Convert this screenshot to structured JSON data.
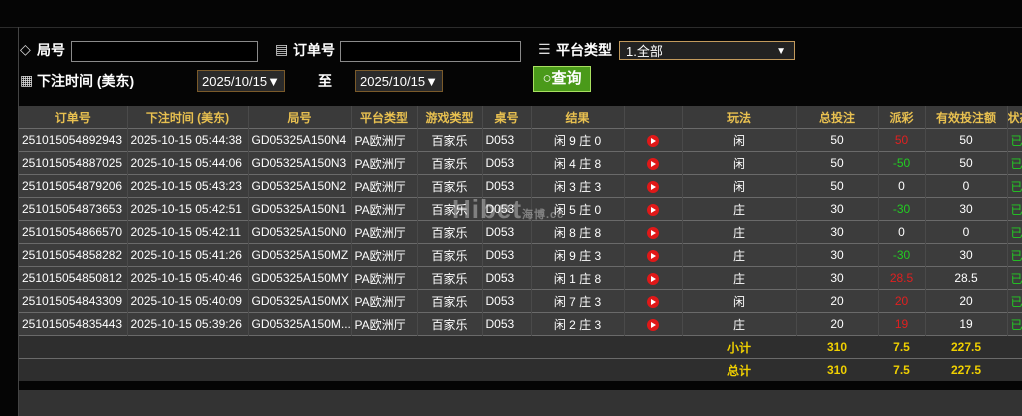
{
  "filters": {
    "game_no_label": "局号",
    "order_no_label": "订单号",
    "platform_label": "平台类型",
    "platform_value": "1.全部",
    "time_label": "下注时间 (美东)",
    "date_from": "2025/10/15▼",
    "to_label": "至",
    "date_to": "2025/10/15▼",
    "query_label": "查询"
  },
  "table": {
    "headers": [
      "订单号",
      "下注时间 (美东)",
      "局号",
      "平台类型",
      "游戏类型",
      "桌号",
      "结果",
      "",
      "玩法",
      "总投注",
      "派彩",
      "有效投注额",
      "状态"
    ],
    "rows": [
      {
        "order": "251015054892943",
        "time": "2025-10-15 05:44:38",
        "game": "GD05325A150N4",
        "platform": "PA欧洲厅",
        "gtype": "百家乐",
        "table": "D053",
        "result": "闲 9 庄 0",
        "play": "闲",
        "bet": "50",
        "payout": "50",
        "payout_color": "red",
        "valid": "50",
        "status": "已派"
      },
      {
        "order": "251015054887025",
        "time": "2025-10-15 05:44:06",
        "game": "GD05325A150N3",
        "platform": "PA欧洲厅",
        "gtype": "百家乐",
        "table": "D053",
        "result": "闲 4 庄 8",
        "play": "闲",
        "bet": "50",
        "payout": "-50",
        "payout_color": "green",
        "valid": "50",
        "status": "已派"
      },
      {
        "order": "251015054879206",
        "time": "2025-10-15 05:43:23",
        "game": "GD05325A150N2",
        "platform": "PA欧洲厅",
        "gtype": "百家乐",
        "table": "D053",
        "result": "闲 3 庄 3",
        "play": "闲",
        "bet": "50",
        "payout": "0",
        "payout_color": "white",
        "valid": "0",
        "status": "已派"
      },
      {
        "order": "251015054873653",
        "time": "2025-10-15 05:42:51",
        "game": "GD05325A150N1",
        "platform": "PA欧洲厅",
        "gtype": "百家乐",
        "table": "D053",
        "result": "闲 5 庄 0",
        "play": "庄",
        "bet": "30",
        "payout": "-30",
        "payout_color": "green",
        "valid": "30",
        "status": "已派"
      },
      {
        "order": "251015054866570",
        "time": "2025-10-15 05:42:11",
        "game": "GD05325A150N0",
        "platform": "PA欧洲厅",
        "gtype": "百家乐",
        "table": "D053",
        "result": "闲 8 庄 8",
        "play": "庄",
        "bet": "30",
        "payout": "0",
        "payout_color": "white",
        "valid": "0",
        "status": "已派"
      },
      {
        "order": "251015054858282",
        "time": "2025-10-15 05:41:26",
        "game": "GD05325A150MZ",
        "platform": "PA欧洲厅",
        "gtype": "百家乐",
        "table": "D053",
        "result": "闲 9 庄 3",
        "play": "庄",
        "bet": "30",
        "payout": "-30",
        "payout_color": "green",
        "valid": "30",
        "status": "已派"
      },
      {
        "order": "251015054850812",
        "time": "2025-10-15 05:40:46",
        "game": "GD05325A150MY",
        "platform": "PA欧洲厅",
        "gtype": "百家乐",
        "table": "D053",
        "result": "闲 1 庄 8",
        "play": "庄",
        "bet": "30",
        "payout": "28.5",
        "payout_color": "red",
        "valid": "28.5",
        "status": "已派"
      },
      {
        "order": "251015054843309",
        "time": "2025-10-15 05:40:09",
        "game": "GD05325A150MX",
        "platform": "PA欧洲厅",
        "gtype": "百家乐",
        "table": "D053",
        "result": "闲 7 庄 3",
        "play": "闲",
        "bet": "20",
        "payout": "20",
        "payout_color": "red",
        "valid": "20",
        "status": "已派"
      },
      {
        "order": "251015054835443",
        "time": "2025-10-15 05:39:26",
        "game": "GD05325A150M...",
        "platform": "PA欧洲厅",
        "gtype": "百家乐",
        "table": "D053",
        "result": "闲 2 庄 3",
        "play": "庄",
        "bet": "20",
        "payout": "19",
        "payout_color": "red",
        "valid": "19",
        "status": "已派"
      }
    ],
    "subtotal": {
      "label": "小计",
      "bet": "310",
      "payout": "7.5",
      "valid": "227.5"
    },
    "total": {
      "label": "总计",
      "bet": "310",
      "payout": "7.5",
      "valid": "227.5"
    }
  },
  "watermark": {
    "main": "Hibet",
    "sub": "海博",
    "suffix": ".cc"
  }
}
